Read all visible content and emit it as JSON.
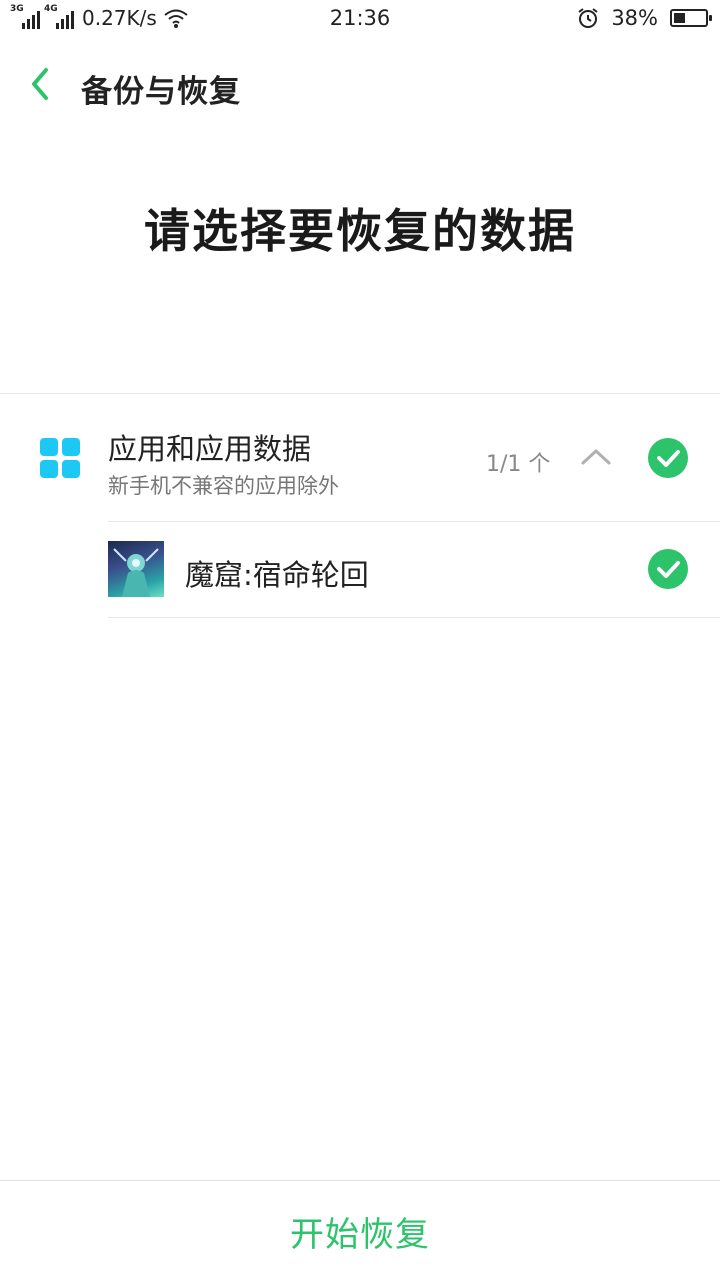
{
  "status_bar": {
    "net1": "3G",
    "net2": "4G",
    "speed": "0.27K/s",
    "time": "21:36",
    "battery": "38%",
    "battery_level": 0.38,
    "icons": [
      "signal-icon",
      "wifi-icon",
      "alarm-icon",
      "battery-icon"
    ]
  },
  "header": {
    "title": "备份与恢复",
    "back_icon": "chevron-left-icon"
  },
  "main_title": "请选择要恢复的数据",
  "category": {
    "title": "应用和应用数据",
    "subtitle": "新手机不兼容的应用除外",
    "count": "1/1 个",
    "expanded": true,
    "checked": true,
    "icon": "apps-grid-icon"
  },
  "apps": [
    {
      "name": "魔窟:宿命轮回",
      "checked": true
    }
  ],
  "footer": {
    "start_label": "开始恢复"
  },
  "colors": {
    "accent": "#2cc36b",
    "apps_icon": "#1ec8f5",
    "text": "#222222",
    "secondary_text": "#777777"
  }
}
